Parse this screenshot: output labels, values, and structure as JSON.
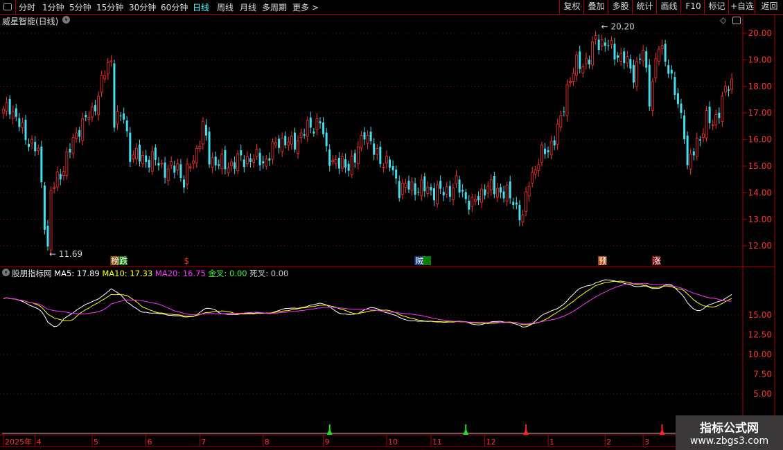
{
  "toolbar": {
    "tabs": [
      "分时",
      "1分钟",
      "5分钟",
      "15分钟",
      "30分钟",
      "60分钟",
      "日线",
      "周线",
      "月线",
      "多周期",
      "更多 >"
    ],
    "active": "日线",
    "right_buttons": [
      "复权",
      "叠加",
      "多股",
      "统计",
      "画线",
      "F10",
      "标记",
      "+自选",
      "返回"
    ]
  },
  "main": {
    "title": "威星智能(日线)",
    "high_label": "20.20",
    "low_label": "11.69",
    "signals": [
      {
        "text": "榜跌",
        "day": 34,
        "colors": [
          "#8a4a10",
          "#0a7a0a"
        ]
      },
      {
        "text": "$",
        "day": 57,
        "colors": [
          "#000"
        ]
      },
      {
        "text": "贼",
        "day": 130,
        "colors": [
          "#0a3a7a",
          "#0a7a0a"
        ]
      },
      {
        "text": "预",
        "day": 188,
        "colors": [
          "#c05010"
        ]
      },
      {
        "text": "涨",
        "day": 205,
        "colors": [
          "#8a0a0a"
        ]
      }
    ]
  },
  "indicator": {
    "name": "股朋指标网",
    "ma5": "MA5: 17.89",
    "ma10": "MA10: 17.33",
    "ma20": "MA20: 16.75",
    "gold": "金叉: 0.00",
    "dead": "死叉: 0.00",
    "crosses": [
      {
        "day": 103,
        "type": "gold"
      },
      {
        "day": 146,
        "type": "gold"
      },
      {
        "day": 165,
        "type": "dead"
      },
      {
        "day": 208,
        "type": "dead"
      }
    ]
  },
  "xaxis": {
    "months": [
      {
        "t": "2025年",
        "day": 0
      },
      {
        "t": "4",
        "day": 10
      },
      {
        "t": "5",
        "day": 28
      },
      {
        "t": "6",
        "day": 45
      },
      {
        "t": "7",
        "day": 62
      },
      {
        "t": "8",
        "day": 82
      },
      {
        "t": "9",
        "day": 101
      },
      {
        "t": "10",
        "day": 121
      },
      {
        "t": "11",
        "day": 135
      },
      {
        "t": "12",
        "day": 152
      },
      {
        "t": "1",
        "day": 172
      },
      {
        "t": "2",
        "day": 190
      },
      {
        "t": "3",
        "day": 202
      }
    ]
  },
  "watermark": {
    "title": "指标公式网",
    "url": "www.zbgs3.com"
  },
  "colors": {
    "up": "#ff3030",
    "down": "#40e0f0",
    "ma5": "#ffffff",
    "ma10": "#ffff00",
    "ma20": "#ff30ff",
    "axis": "#b00000"
  },
  "chart_data": {
    "type": "candlestick",
    "ylim": [
      11.5,
      20.5
    ],
    "yticks": [
      "20.00",
      "19.00",
      "18.00",
      "17.00",
      "16.00",
      "15.00",
      "14.00",
      "13.00",
      "12.00"
    ],
    "lower_yticks": [
      "15.00",
      "12.50",
      "10.00",
      "7.50",
      "5.00"
    ],
    "closes": [
      [
        0,
        17.0
      ],
      [
        2,
        17.3
      ],
      [
        6,
        16.3
      ],
      [
        11,
        15.5
      ],
      [
        13,
        13.0
      ],
      [
        14,
        11.9
      ],
      [
        15,
        14.0
      ],
      [
        19,
        15.0
      ],
      [
        24,
        16.5
      ],
      [
        28,
        17.0
      ],
      [
        32,
        18.5
      ],
      [
        34,
        19.0
      ],
      [
        35,
        16.8
      ],
      [
        38,
        16.8
      ],
      [
        40,
        15.5
      ],
      [
        43,
        15.3
      ],
      [
        48,
        15.2
      ],
      [
        52,
        14.8
      ],
      [
        55,
        15.0
      ],
      [
        57,
        14.4
      ],
      [
        61,
        15.6
      ],
      [
        63,
        16.5
      ],
      [
        65,
        15.3
      ],
      [
        70,
        15.0
      ],
      [
        74,
        15.2
      ],
      [
        78,
        15.3
      ],
      [
        83,
        15.2
      ],
      [
        87,
        16.0
      ],
      [
        91,
        15.8
      ],
      [
        96,
        16.4
      ],
      [
        100,
        16.7
      ],
      [
        102,
        15.5
      ],
      [
        106,
        15.0
      ],
      [
        111,
        15.2
      ],
      [
        114,
        16.4
      ],
      [
        117,
        15.5
      ],
      [
        122,
        15.0
      ],
      [
        125,
        14.2
      ],
      [
        130,
        14.2
      ],
      [
        135,
        14.1
      ],
      [
        139,
        14.0
      ],
      [
        143,
        14.3
      ],
      [
        148,
        13.5
      ],
      [
        152,
        14.2
      ],
      [
        157,
        14.1
      ],
      [
        161,
        13.7
      ],
      [
        164,
        13.0
      ],
      [
        166,
        14.5
      ],
      [
        170,
        15.4
      ],
      [
        174,
        16.0
      ],
      [
        176,
        16.7
      ],
      [
        178,
        18.0
      ],
      [
        181,
        18.8
      ],
      [
        185,
        19.0
      ],
      [
        187,
        19.8
      ],
      [
        191,
        19.5
      ],
      [
        196,
        19.0
      ],
      [
        199,
        18.5
      ],
      [
        202,
        19.3
      ],
      [
        204,
        17.6
      ],
      [
        207,
        19.5
      ],
      [
        210,
        18.8
      ],
      [
        212,
        17.7
      ],
      [
        215,
        16.4
      ],
      [
        216,
        15.0
      ],
      [
        218,
        15.5
      ],
      [
        222,
        16.8
      ],
      [
        224,
        16.5
      ],
      [
        226,
        17.2
      ],
      [
        228,
        17.8
      ],
      [
        230,
        18.1
      ]
    ]
  }
}
